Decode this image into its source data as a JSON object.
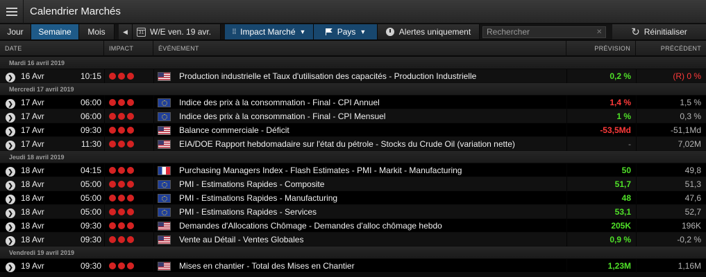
{
  "app": {
    "title": "Calendrier Marchés"
  },
  "toolbar": {
    "tabs": [
      "Jour",
      "Semaine",
      "Mois"
    ],
    "active_tab": "Semaine",
    "prev_label": "◀",
    "calendar_day": "31",
    "date_label": "W/E ven. 19 avr.",
    "impact_label": "Impact Marché",
    "country_label": "Pays",
    "alerts_label": "Alertes uniquement",
    "search_placeholder": "Rechercher",
    "reset_label": "Réinitialiser"
  },
  "columns": {
    "date": "DATE",
    "impact": "IMPACT",
    "event": "ÉVÉNEMENT",
    "forecast": "PRÉVISION",
    "previous": "PRÉCÉDENT"
  },
  "colors": {
    "accent": "#1e5a88",
    "positive": "#4fe028",
    "negative": "#ff3a3a",
    "impact": "#d42222"
  },
  "days": [
    {
      "label": "Mardi 16 avril 2019",
      "events": [
        {
          "date": "16 Avr",
          "time": "10:15",
          "impact": 3,
          "country": "US",
          "event": "Production industrielle et Taux d'utilisation des capacités - Production Industrielle",
          "forecast": "0,2 %",
          "forecast_color": "green",
          "previous": "(R) 0 %",
          "previous_color": "red"
        }
      ]
    },
    {
      "label": "Mercredi 17 avril 2019",
      "events": [
        {
          "date": "17 Avr",
          "time": "06:00",
          "impact": 3,
          "country": "EU",
          "event": "Indice des prix à la consommation - Final - CPI Annuel",
          "forecast": "1,4 %",
          "forecast_color": "red",
          "previous": "1,5 %",
          "previous_color": ""
        },
        {
          "date": "17 Avr",
          "time": "06:00",
          "impact": 3,
          "country": "EU",
          "event": "Indice des prix à la consommation - Final - CPI Mensuel",
          "forecast": "1 %",
          "forecast_color": "green",
          "previous": "0,3 %",
          "previous_color": ""
        },
        {
          "date": "17 Avr",
          "time": "09:30",
          "impact": 3,
          "country": "US",
          "event": "Balance commerciale - Déficit",
          "forecast": "-53,5Md",
          "forecast_color": "red",
          "previous": "-51,1Md",
          "previous_color": ""
        },
        {
          "date": "17 Avr",
          "time": "11:30",
          "impact": 3,
          "country": "US",
          "event": "EIA/DOE Rapport hebdomadaire sur l'état du pétrole - Stocks du Crude Oil (variation nette)",
          "forecast": "-",
          "forecast_color": "dim",
          "previous": "7,02M",
          "previous_color": ""
        }
      ]
    },
    {
      "label": "Jeudi 18 avril 2019",
      "events": [
        {
          "date": "18 Avr",
          "time": "04:15",
          "impact": 3,
          "country": "FR",
          "event": "Purchasing Managers Index - Flash Estimates - PMI - Markit - Manufacturing",
          "forecast": "50",
          "forecast_color": "green",
          "previous": "49,8",
          "previous_color": ""
        },
        {
          "date": "18 Avr",
          "time": "05:00",
          "impact": 3,
          "country": "EU",
          "event": "PMI - Estimations Rapides - Composite",
          "forecast": "51,7",
          "forecast_color": "green",
          "previous": "51,3",
          "previous_color": ""
        },
        {
          "date": "18 Avr",
          "time": "05:00",
          "impact": 3,
          "country": "EU",
          "event": "PMI - Estimations Rapides - Manufacturing",
          "forecast": "48",
          "forecast_color": "green",
          "previous": "47,6",
          "previous_color": ""
        },
        {
          "date": "18 Avr",
          "time": "05:00",
          "impact": 3,
          "country": "EU",
          "event": "PMI - Estimations Rapides - Services",
          "forecast": "53,1",
          "forecast_color": "green",
          "previous": "52,7",
          "previous_color": ""
        },
        {
          "date": "18 Avr",
          "time": "09:30",
          "impact": 3,
          "country": "US",
          "event": "Demandes d'Allocations Chômage - Demandes d'alloc chômage hebdo",
          "forecast": "205K",
          "forecast_color": "green",
          "previous": "196K",
          "previous_color": ""
        },
        {
          "date": "18 Avr",
          "time": "09:30",
          "impact": 3,
          "country": "US",
          "event": "Vente au Détail - Ventes Globales",
          "forecast": "0,9 %",
          "forecast_color": "green",
          "previous": "-0,2 %",
          "previous_color": ""
        }
      ]
    },
    {
      "label": "Vendredi 19 avril 2019",
      "events": [
        {
          "date": "19 Avr",
          "time": "09:30",
          "impact": 3,
          "country": "US",
          "event": "Mises en chantier - Total des Mises en Chantier",
          "forecast": "1,23M",
          "forecast_color": "green",
          "previous": "1,16M",
          "previous_color": ""
        }
      ]
    }
  ]
}
